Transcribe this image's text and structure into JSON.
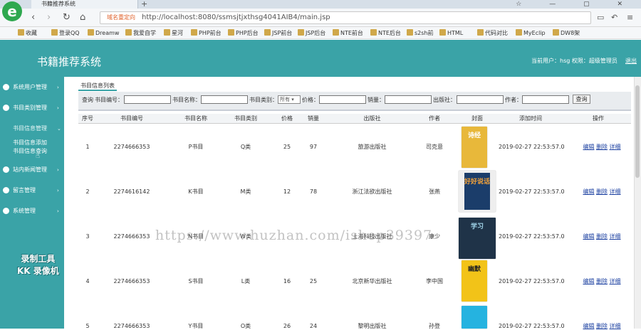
{
  "browser": {
    "tab_title": "书籍推荐系统",
    "new_tab_icon": "+",
    "window_controls": "☆ — ▢ ✕",
    "url_tag": "域名重定向",
    "url": "http://localhost:8080/ssmsjtjxthsg4041AIB4/main.jsp",
    "bookmarks": [
      "收藏",
      "登录QQ",
      "Dreamw",
      "我爱自学",
      "星河",
      "PHP前台",
      "PHP后台",
      "JSP前台",
      "JSP后台",
      "NTE前台",
      "NTE后台",
      "s2sh前",
      "HTML",
      "代码对比",
      "MyEclip",
      "DW8架"
    ]
  },
  "app": {
    "title": "书籍推荐系统",
    "user_info": "当前用户：hsg  权限：超级管理员",
    "logout": "退出"
  },
  "sidebar": {
    "items": [
      {
        "label": "系统用户管理",
        "arrow": "›"
      },
      {
        "label": "书目类别管理",
        "arrow": "›"
      },
      {
        "label": "书目信息管理",
        "arrow": "⌄"
      },
      {
        "label": "站内新闻管理",
        "arrow": "›"
      },
      {
        "label": "留言管理",
        "arrow": "›"
      },
      {
        "label": "系统管理",
        "arrow": "›"
      }
    ],
    "subitems": [
      "书目信息添加",
      "书目信息查询"
    ],
    "watermark_lines": [
      "录制工具",
      "KK 录像机"
    ]
  },
  "page": {
    "tab": "书目信息列表",
    "search": {
      "prefix": "查询",
      "code_label": "书目编号：",
      "name_label": "书目名称：",
      "type_label": "书目类别：",
      "type_value": "所有 ▾",
      "price_label": "价格：",
      "sales_label": "销量：",
      "publisher_label": "出版社：",
      "author_label": "作者：",
      "button": "查询"
    },
    "columns": [
      "序号",
      "书目编号",
      "书目名称",
      "书目类别",
      "价格",
      "销量",
      "出版社",
      "作者",
      "封面",
      "添加时间",
      "操作"
    ],
    "actions": [
      "编辑",
      "删除",
      "详细"
    ],
    "rows": [
      {
        "no": "1",
        "code": "2274666353",
        "name": "P书目",
        "type": "Q类",
        "price": "25",
        "sales": "97",
        "publisher": "旅游出版社",
        "author": "司克意",
        "cover_text": "诗经",
        "time": "2019-02-27 22:53:57.0"
      },
      {
        "no": "2",
        "code": "2274616142",
        "name": "K书目",
        "type": "M类",
        "price": "12",
        "sales": "78",
        "publisher": "浙江法欲出版社",
        "author": "张燕",
        "cover_text": "好好说话",
        "time": "2019-02-27 22:53:57.0"
      },
      {
        "no": "3",
        "code": "2274666353",
        "name": "N书目",
        "type": "W类",
        "price": "",
        "sales": "",
        "publisher": "上海科技出版社",
        "author": "康少",
        "cover_text": "学习",
        "time": "2019-02-27 22:53:57.0"
      },
      {
        "no": "4",
        "code": "2274666353",
        "name": "S书目",
        "type": "L类",
        "price": "16",
        "sales": "25",
        "publisher": "北京新华出版社",
        "author": "李中国",
        "cover_text": "幽默",
        "time": "2019-02-27 22:53:57.0"
      },
      {
        "no": "5",
        "code": "2274666353",
        "name": "Y书目",
        "type": "O类",
        "price": "26",
        "sales": "24",
        "publisher": "黎明出版社",
        "author": "孙登",
        "cover_text": "",
        "time": "2019-02-27 22:53:57.0"
      }
    ]
  },
  "overlay_watermark": "https://www.huzhan.com/ishop39397",
  "colors": {
    "header": "#3aa3a7",
    "link": "#1a3fa0"
  }
}
